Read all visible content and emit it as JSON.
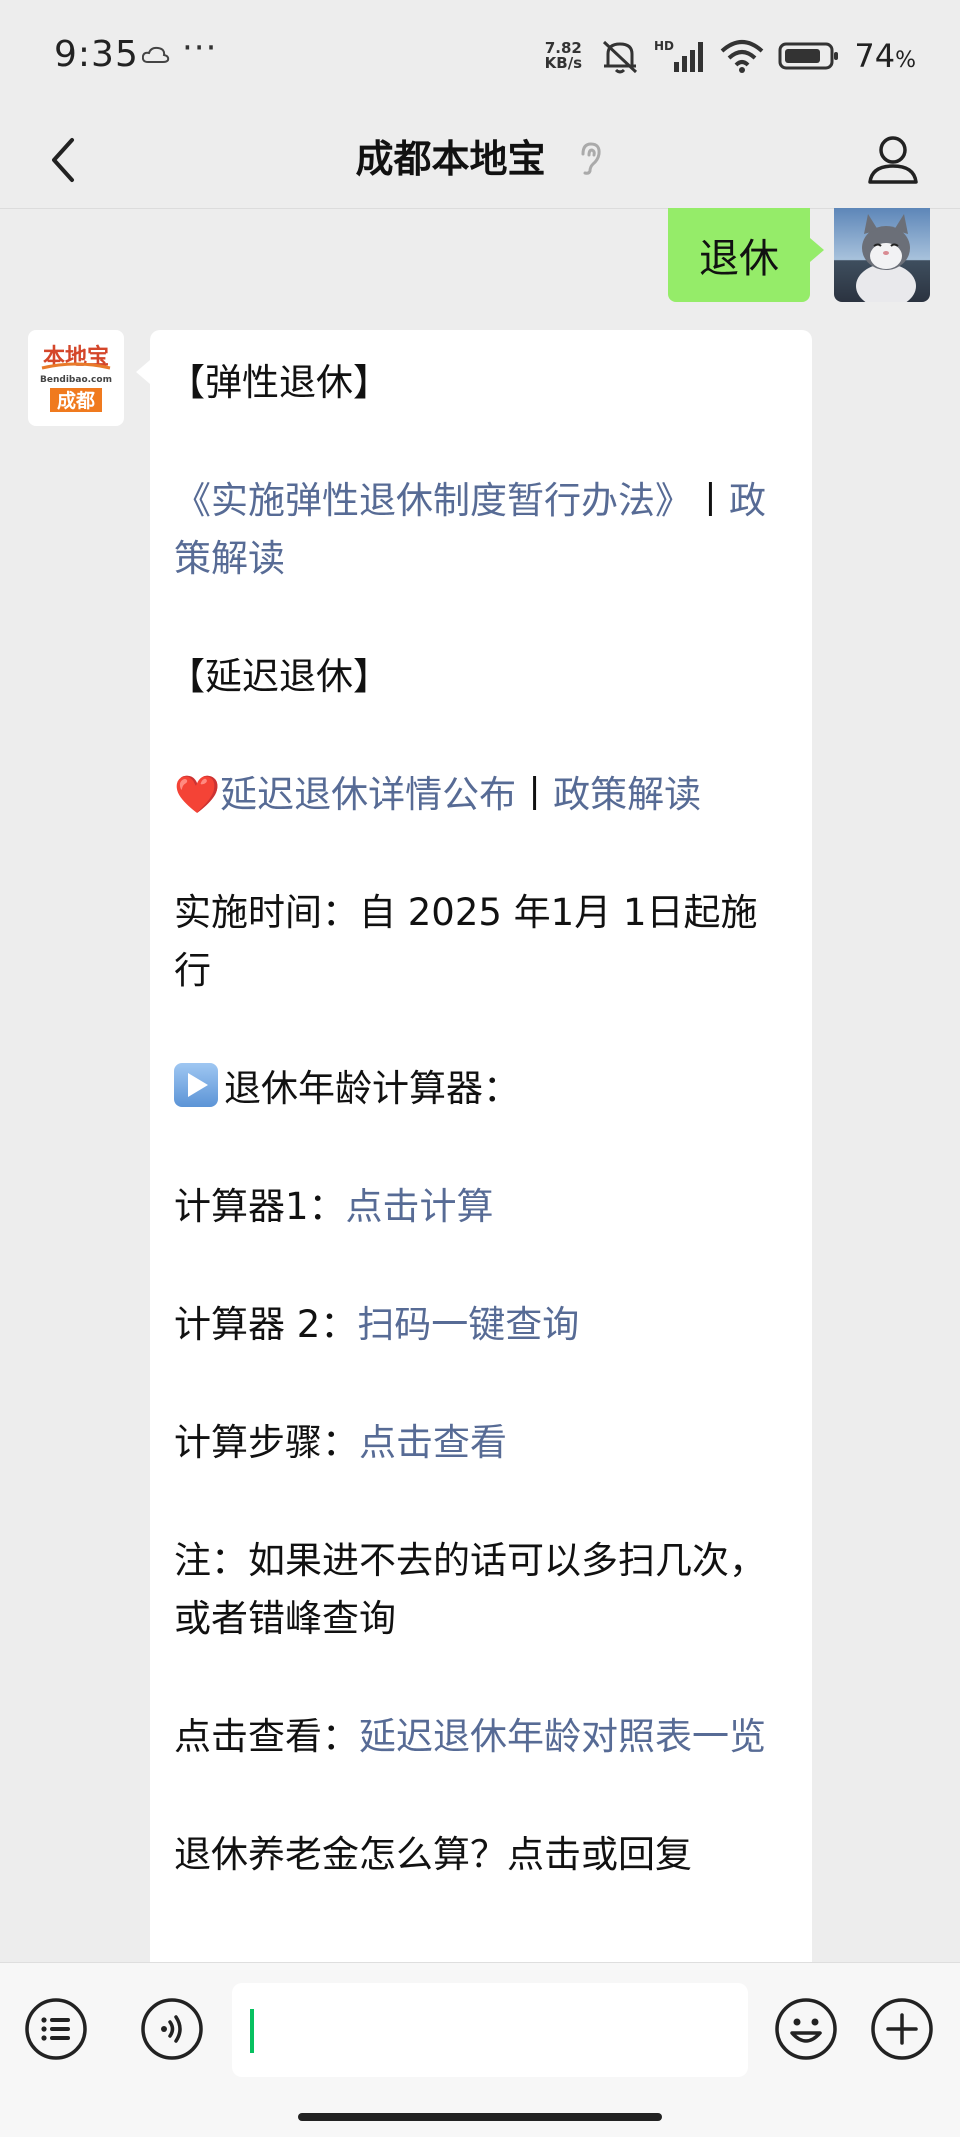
{
  "status_bar": {
    "time": "9:35",
    "dots": "···",
    "net_speed_value": "7.82",
    "net_speed_unit": "KB/s",
    "hd": "HD",
    "battery_pct": "74",
    "pct_sign": "%"
  },
  "header": {
    "title": "成都本地宝"
  },
  "sent_message": {
    "text": "退休"
  },
  "bot_avatar": {
    "top_text": "本地宝",
    "domain": "Bendibao.com",
    "city": "成都"
  },
  "received_message": {
    "section1_title": "【弹性退休】",
    "section1_link1": "《实施弹性退休制度暂行办法》",
    "section1_sep": "丨",
    "section1_link2": "政策解读",
    "section2_title": "【延迟退休】",
    "heart": "❤️",
    "section2_link1": "延迟退休详情公布",
    "section2_sep": "丨",
    "section2_link2": "政策解读",
    "implement_time": "实施时间：自 2025 年1月 1日起施行",
    "calculator_title": "退休年龄计算器：",
    "calc1_label": "计算器1：",
    "calc1_link": "点击计算",
    "calc2_label": "计算器 2：",
    "calc2_link": "扫码一键查询",
    "steps_label": "计算步骤：",
    "steps_link": "点击查看",
    "note": "注：如果进不去的话可以多扫几次，或者错峰查询",
    "table_label": "点击查看：",
    "table_link": "延迟退休年龄对照表一览",
    "pension_text": "退休养老金怎么算？点击或回复"
  },
  "colors": {
    "link": "#576b95",
    "bubble_sent": "#95ec69",
    "background": "#ededed",
    "cursor": "#07c160"
  },
  "icons": [
    "back-arrow-icon",
    "ear-icon",
    "profile-icon",
    "menu-list-icon",
    "voice-icon",
    "emoji-icon",
    "plus-icon"
  ]
}
